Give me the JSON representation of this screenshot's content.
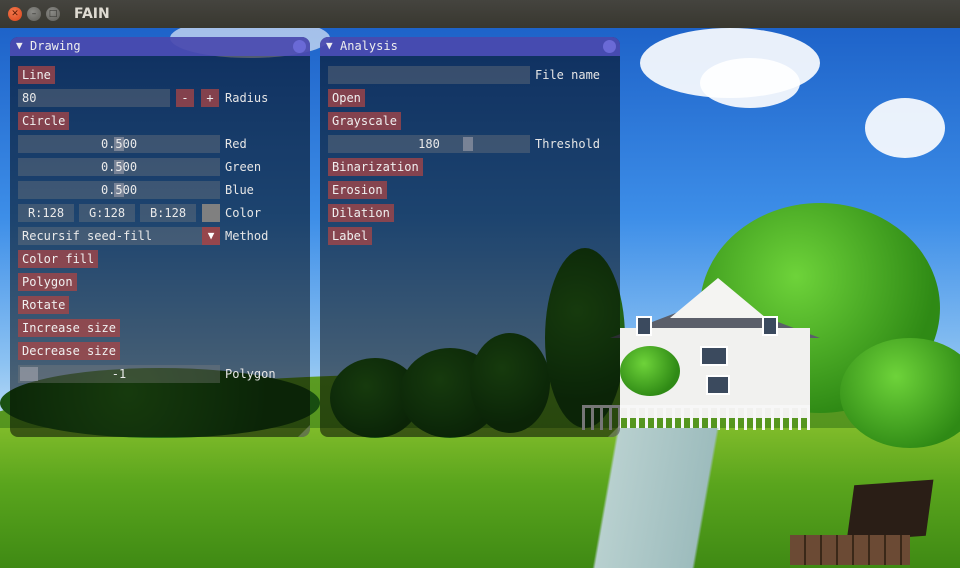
{
  "window": {
    "title": "FAIN"
  },
  "drawing": {
    "title": "Drawing",
    "line_btn": "Line",
    "radius": {
      "value": "80",
      "minus": "-",
      "plus": "+",
      "label": "Radius"
    },
    "circle_btn": "Circle",
    "red": {
      "value": "0.500",
      "level": 0.5,
      "label": "Red"
    },
    "green": {
      "value": "0.500",
      "level": 0.5,
      "label": "Green"
    },
    "blue": {
      "value": "0.500",
      "level": 0.5,
      "label": "Blue"
    },
    "color": {
      "r": "R:128",
      "g": "G:128",
      "b": "B:128",
      "swatch": "#808080",
      "label": "Color"
    },
    "method": {
      "value": "Recursif seed-fill",
      "label": "Method"
    },
    "color_fill_btn": "Color fill",
    "polygon_btn": "Polygon",
    "rotate_btn": "Rotate",
    "increase_btn": "Increase size",
    "decrease_btn": "Decrease size",
    "polygon_slider": {
      "value": "-1",
      "label": "Polygon"
    }
  },
  "analysis": {
    "title": "Analysis",
    "file_name": {
      "value": "",
      "label": "File name"
    },
    "open_btn": "Open",
    "grayscale_btn": "Grayscale",
    "threshold": {
      "value": "180",
      "level": 0.706,
      "label": "Threshold"
    },
    "binarization_btn": "Binarization",
    "erosion_btn": "Erosion",
    "dilation_btn": "Dilation",
    "label_btn": "Label"
  },
  "colors": {
    "panel_title": "#5050be",
    "button": "#aa4646"
  }
}
